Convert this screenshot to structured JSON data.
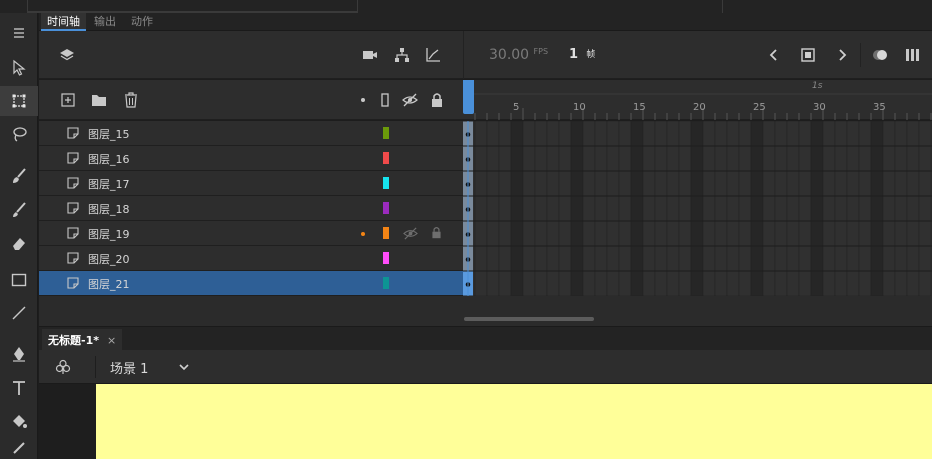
{
  "panel_tabs": [
    "时间轴",
    "输出",
    "动作"
  ],
  "timeline": {
    "fps": "30.00",
    "fps_unit": "FPS",
    "frame": "1",
    "frame_unit": "帧",
    "ruler": {
      "second_label": "1s",
      "ticks": [
        "5",
        "10",
        "15",
        "20",
        "25",
        "30",
        "35"
      ]
    },
    "layers": [
      {
        "name": "图层_15",
        "color": "#6b9a0a"
      },
      {
        "name": "图层_16",
        "color": "#f04a4a"
      },
      {
        "name": "图层_17",
        "color": "#16e4ee"
      },
      {
        "name": "图层_18",
        "color": "#9b2bbe"
      },
      {
        "name": "图层_19",
        "color": "#f38415",
        "hidden": true,
        "locked": true
      },
      {
        "name": "图层_20",
        "color": "#ff4dfa"
      },
      {
        "name": "图层_21",
        "color": "#0d9494",
        "selected": true
      }
    ]
  },
  "document": {
    "tab_title": "无标题-1*",
    "close_glyph": "×",
    "scene_label": "场景 1"
  },
  "colors": {
    "selection": "#2e5f96",
    "playhead": "#4a90d9",
    "stage": "#ffff99"
  }
}
